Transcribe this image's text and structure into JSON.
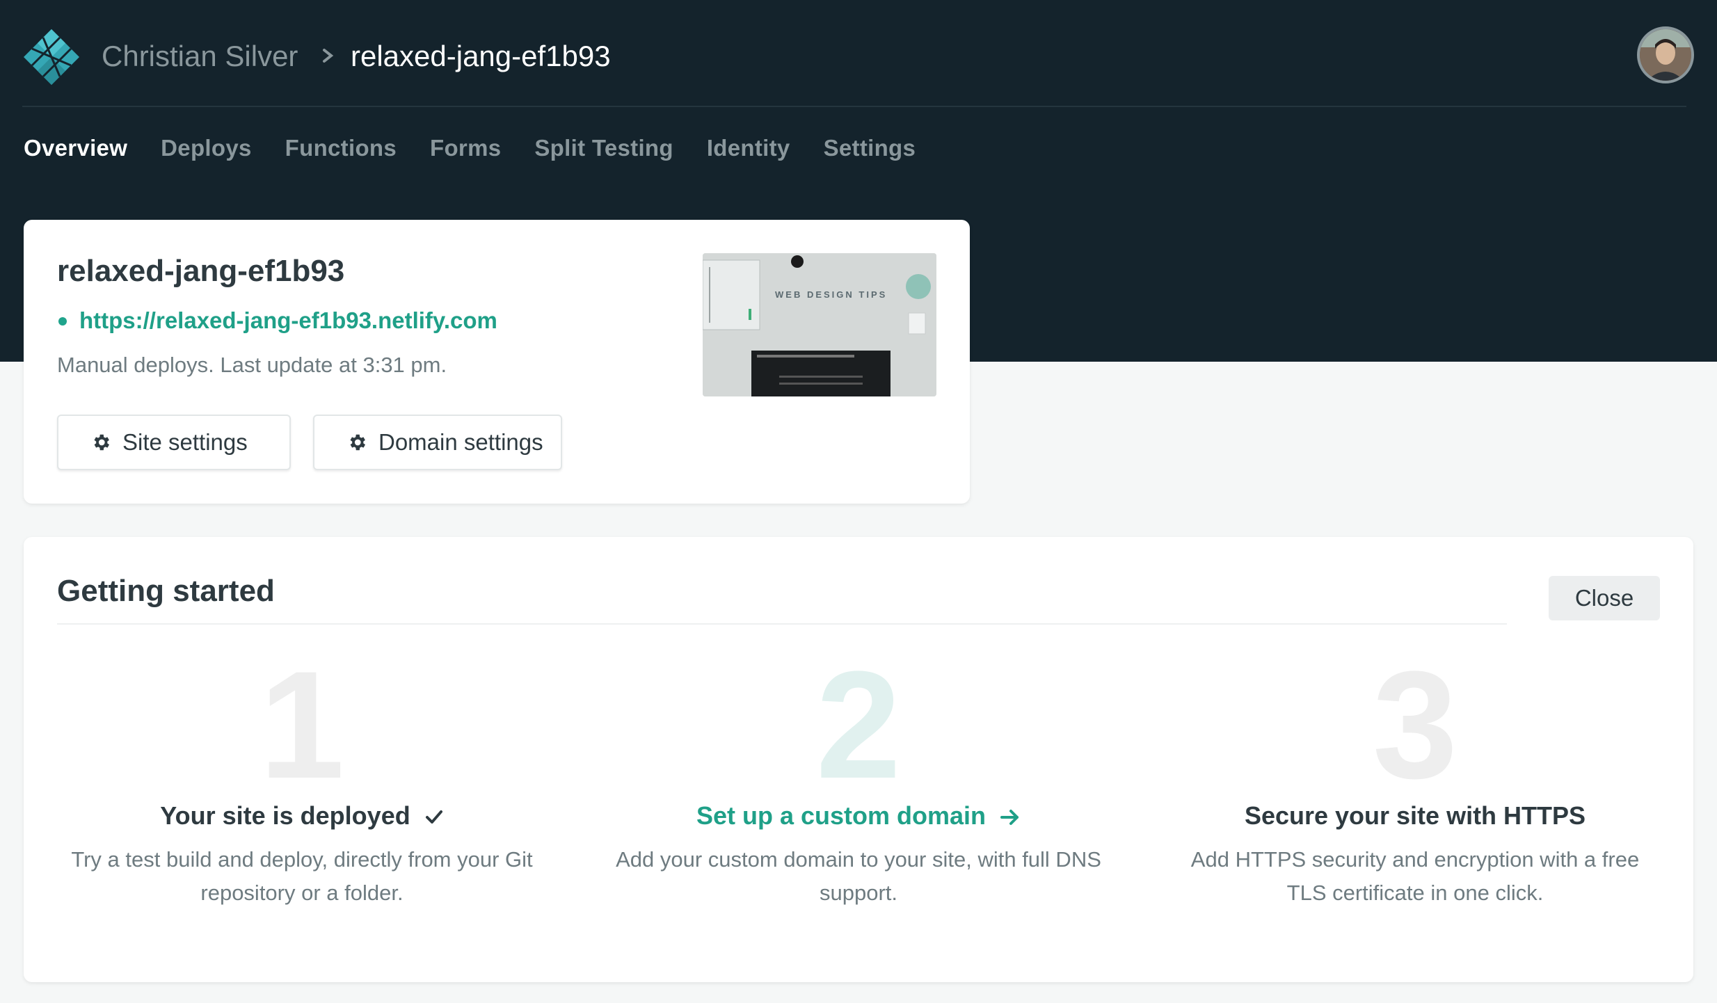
{
  "colors": {
    "header_bg": "#14232c",
    "accent": "#1fa088",
    "text_dark": "#2e3a40",
    "text_muted": "#6e7b80",
    "nav_muted": "#8a979c"
  },
  "topbar": {
    "logo_icon": "netlify-logo-icon",
    "owner": "Christian Silver",
    "separator_icon": "chevron-right-icon",
    "site": "relaxed-jang-ef1b93",
    "avatar_icon": "user-avatar"
  },
  "nav": {
    "tabs": [
      {
        "label": "Overview",
        "active": true
      },
      {
        "label": "Deploys"
      },
      {
        "label": "Functions"
      },
      {
        "label": "Forms"
      },
      {
        "label": "Split Testing"
      },
      {
        "label": "Identity"
      },
      {
        "label": "Settings"
      }
    ]
  },
  "site_card": {
    "title": "relaxed-jang-ef1b93",
    "url": "https://relaxed-jang-ef1b93.netlify.com",
    "meta": "Manual deploys. Last update at 3:31 pm.",
    "buttons": {
      "site_settings": "Site settings",
      "domain_settings": "Domain settings",
      "icon": "gear-icon"
    },
    "thumbnail": {
      "caption": "WEB DESIGN TIPS"
    }
  },
  "getting_started": {
    "title": "Getting started",
    "close_label": "Close",
    "steps": [
      {
        "number": "1",
        "title": "Your site is deployed",
        "icon": "checkmark-icon",
        "description": "Try a test build and deploy, directly from your Git repository or a folder."
      },
      {
        "number": "2",
        "title": "Set up a custom domain",
        "icon": "arrow-right-icon",
        "description": "Add your custom domain to your site, with full DNS support."
      },
      {
        "number": "3",
        "title": "Secure your site with HTTPS",
        "description": "Add HTTPS security and encryption with a free TLS certificate in one click."
      }
    ]
  }
}
